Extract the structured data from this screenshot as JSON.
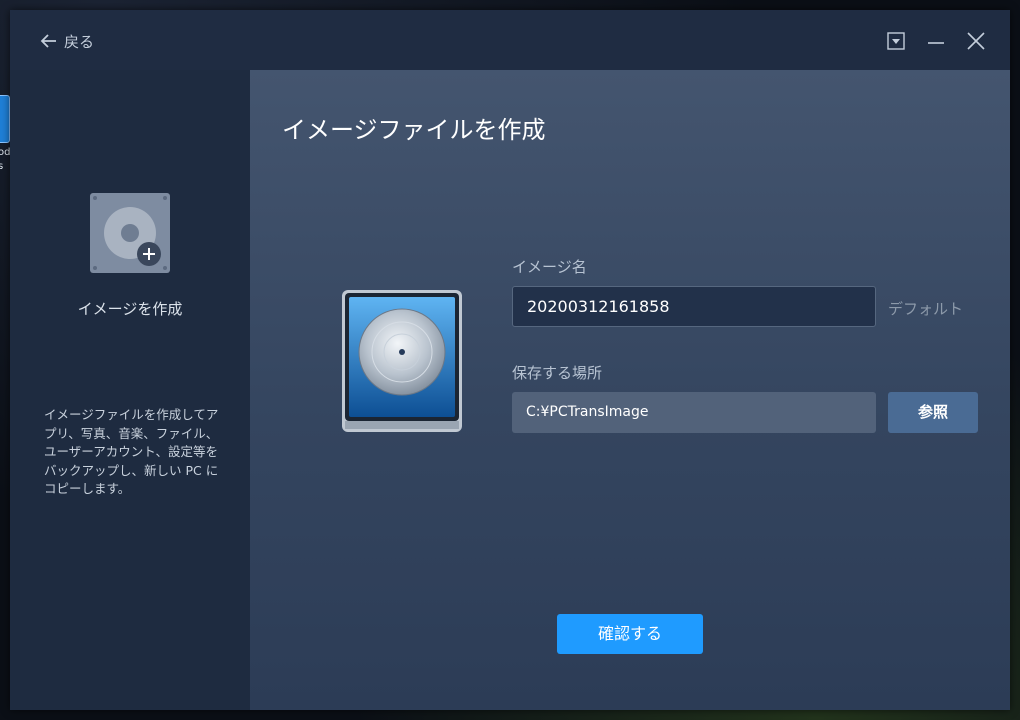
{
  "desktop": {
    "icon_label": "od s"
  },
  "titlebar": {
    "back_label": "戻る",
    "controls": [
      "dropdown-icon",
      "minimize-icon",
      "close-icon"
    ]
  },
  "sidebar": {
    "title": "イメージを作成",
    "description": "イメージファイルを作成してアプリ、写真、音楽、ファイル、ユーザーアカウント、設定等をバックアップし、新しい PC にコピーします。"
  },
  "main": {
    "title": "イメージファイルを作成",
    "image_name_label": "イメージ名",
    "image_name_value": "20200312161858",
    "default_label": "デフォルト",
    "location_label": "保存する場所",
    "location_value": "C:¥PCTransImage",
    "browse_label": "参照",
    "confirm_label": "確認する"
  },
  "colors": {
    "accent": "#1f9bff",
    "window_bg": "#2b3b55",
    "sidebar_bg": "#1e2b40",
    "titlebar_bg": "#1f2c42",
    "browse_bg": "#4a6b94"
  }
}
